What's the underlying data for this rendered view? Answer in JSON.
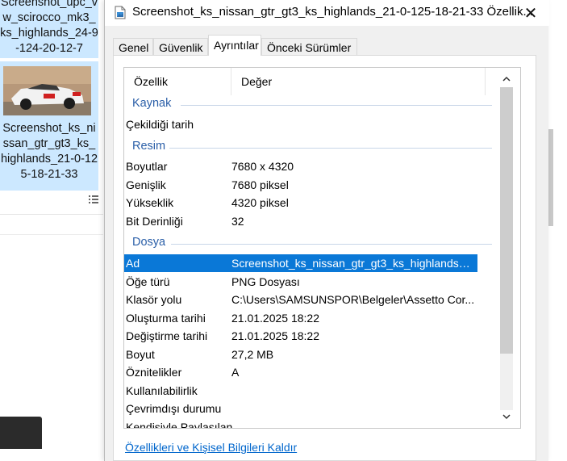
{
  "explorer": {
    "prev_file_name": "Screenshot_upc_vw_scirocco_mk3_ks_highlands_24-9-124-20-12-7",
    "selected_file_name": "Screenshot_ks_nissan_gtr_gt3_ks_highlands_21-0-125-18-21-33"
  },
  "dialog": {
    "title": "Screenshot_ks_nissan_gtr_gt3_ks_highlands_21-0-125-18-21-33 Özellik...",
    "close_glyph": "✕",
    "tabs": [
      "Genel",
      "Güvenlik",
      "Ayrıntılar",
      "Önceki Sürümler"
    ],
    "active_tab": "Ayrıntılar",
    "columns": {
      "property": "Özellik",
      "value": "Değer"
    },
    "groups": [
      {
        "title": "Kaynak"
      },
      {
        "title": "Resim"
      },
      {
        "title": "Dosya"
      }
    ],
    "rows": [
      {
        "property": "Çekildiği tarih",
        "value": ""
      },
      {
        "property": "Boyutlar",
        "value": "7680 x 4320"
      },
      {
        "property": "Genişlik",
        "value": "7680 piksel"
      },
      {
        "property": "Yükseklik",
        "value": "4320 piksel"
      },
      {
        "property": "Bit Derinliği",
        "value": "32"
      },
      {
        "property": "Ad",
        "value": "Screenshot_ks_nissan_gtr_gt3_ks_highlands_2..."
      },
      {
        "property": "Öğe türü",
        "value": "PNG Dosyası"
      },
      {
        "property": "Klasör yolu",
        "value": "C:\\Users\\SAMSUNSPOR\\Belgeler\\Assetto Cor..."
      },
      {
        "property": "Oluşturma tarihi",
        "value": "21.01.2025 18:22"
      },
      {
        "property": "Değiştirme tarihi",
        "value": "21.01.2025 18:22"
      },
      {
        "property": "Boyut",
        "value": "27,2 MB"
      },
      {
        "property": "Öznitelikler",
        "value": "A"
      },
      {
        "property": "Kullanılabilirlik",
        "value": ""
      },
      {
        "property": "Çevrimdışı durumu",
        "value": ""
      },
      {
        "property": "Kendisiyle Paylaşılan",
        "value": ""
      }
    ],
    "selected_row": "Ad",
    "remove_link": "Özellikleri ve Kişisel Bilgileri Kaldır"
  },
  "colors": {
    "accent": "#0a78d7",
    "group_title": "#2b5fa8",
    "link": "#0066cc",
    "selection_bg": "#cce8ff"
  },
  "icons": {
    "title": "image-file-icon",
    "close": "close-icon",
    "scroll_up": "chevron-up-icon",
    "scroll_down": "chevron-down-icon",
    "view": "details-view-icon"
  }
}
